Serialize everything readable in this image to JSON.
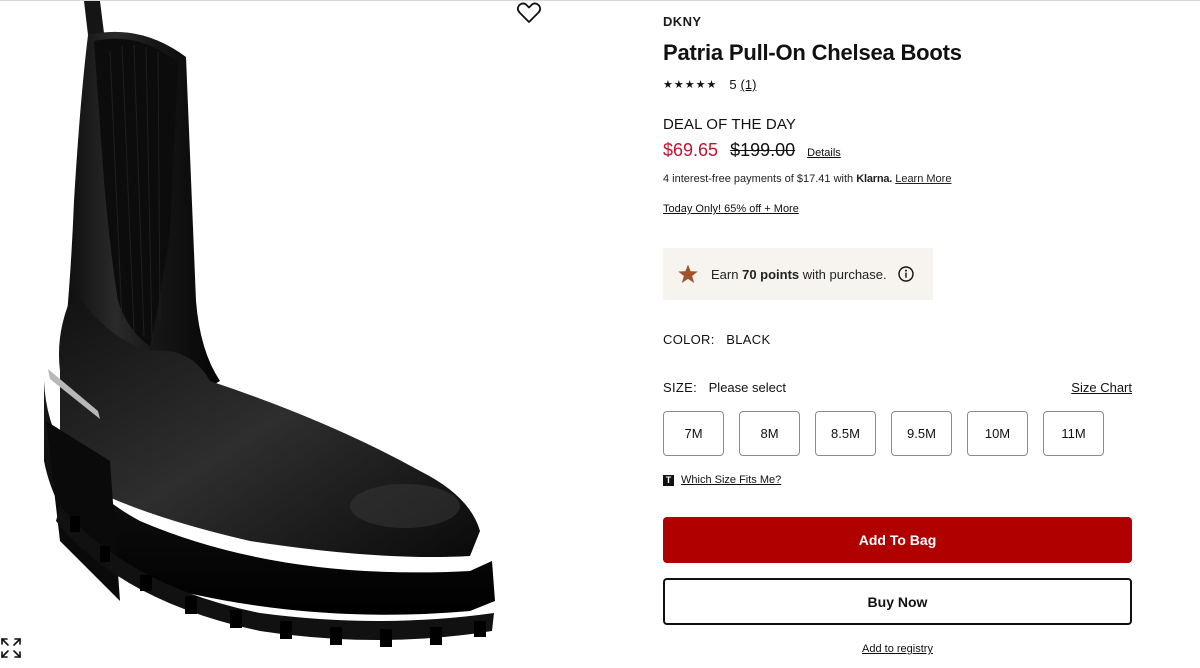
{
  "gallery": {
    "image_alt": "black leather chelsea boot",
    "wishlist_icon": "heart-icon",
    "expand_icon": "expand-icon"
  },
  "product": {
    "brand": "DKNY",
    "title": "Patria Pull-On Chelsea Boots",
    "rating": {
      "stars": "★★★★★",
      "score": "5",
      "count": "(1)"
    },
    "deal_label": "DEAL OF THE DAY",
    "price": {
      "sale": "$69.65",
      "original": "$199.00",
      "details_label": "Details",
      "sale_color": "#c8102e"
    },
    "klarna": {
      "text": "4 interest-free payments of $17.41 with",
      "brand": "Klarna.",
      "link": "Learn More"
    },
    "promo": "Today Only! 65% off + More",
    "points": {
      "prefix": "Earn",
      "amount": "70 points",
      "suffix": "with purchase.",
      "star_icon": "star-icon",
      "info_icon": "info-icon",
      "star_color": "#a0522d"
    },
    "color": {
      "label": "COLOR:",
      "value": "BLACK"
    },
    "size": {
      "label": "SIZE:",
      "value": "Please select",
      "chart_link": "Size Chart",
      "options": [
        "7M",
        "8M",
        "8.5M",
        "9.5M",
        "10M",
        "11M"
      ]
    },
    "fit": {
      "icon_letter": "T",
      "link": "Which Size Fits Me?"
    },
    "actions": {
      "add_to_bag": "Add To Bag",
      "buy_now": "Buy Now",
      "registry": "Add to registry",
      "primary_color": "#b00000"
    }
  }
}
